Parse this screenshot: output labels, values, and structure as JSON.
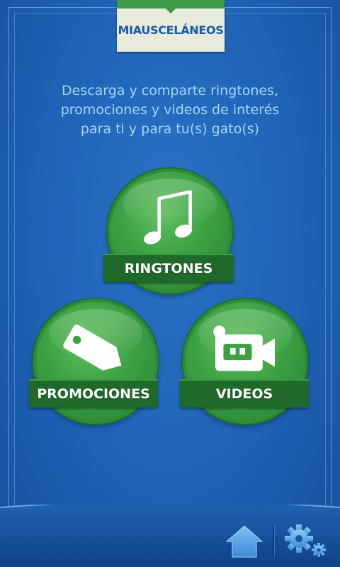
{
  "header": {
    "title": "MIAUSCELÁNEOS"
  },
  "intro": {
    "line1": "Descarga y comparte ringtones,",
    "line2": "promociones y videos de interés",
    "line3": "para ti y para tu(s) gato(s)"
  },
  "menu": {
    "ringtones": {
      "label": "RINGTONES",
      "icon": "music-note-icon"
    },
    "promociones": {
      "label": "PROMOCIONES",
      "icon": "price-tag-icon"
    },
    "videos": {
      "label": "VIDEOS",
      "icon": "video-camera-icon"
    }
  },
  "bottom_bar": {
    "home_icon": "home-icon",
    "settings_icon": "settings-gears-icon"
  },
  "colors": {
    "background": "#1e62b6",
    "button_green": "#3ca143",
    "ribbon_green": "#1f6a2a",
    "title_text": "#1b5aa8",
    "intro_text": "#a8d3f5"
  }
}
